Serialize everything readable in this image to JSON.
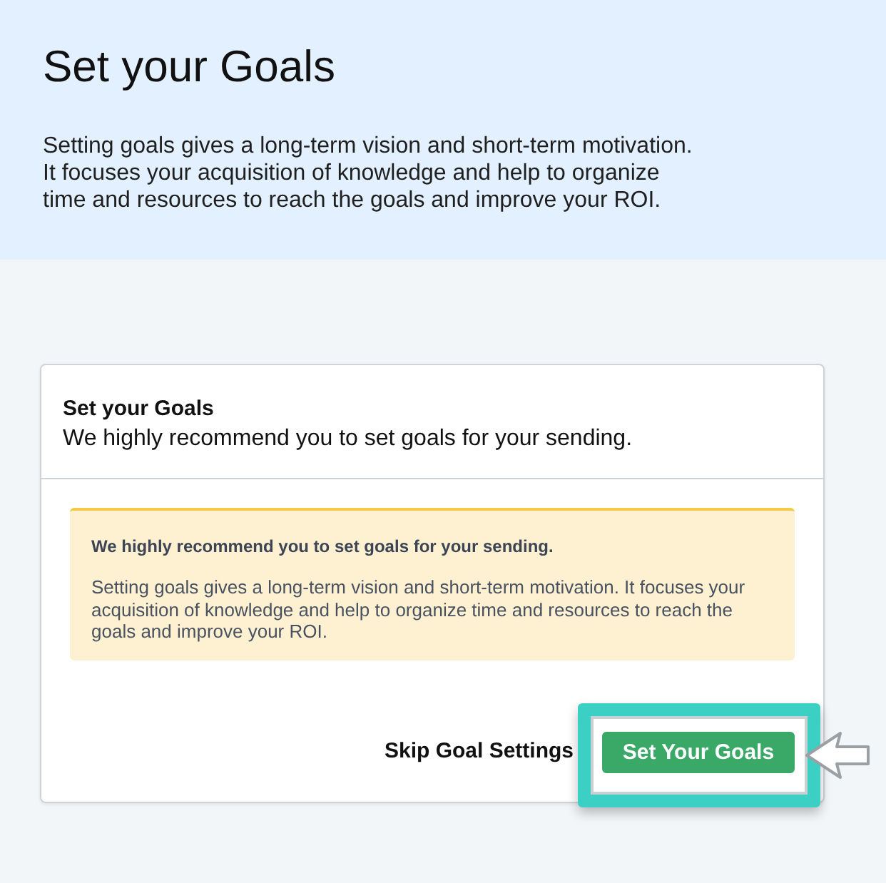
{
  "header": {
    "title": "Set your Goals",
    "description": "Setting goals gives a long-term vision and short-term motivation. It focuses your acquisition of knowledge and help to organize time and resources to reach the goals and improve your ROI."
  },
  "card": {
    "title": "Set your Goals",
    "subtitle": "We highly recommend you to set goals for your sending.",
    "alert": {
      "kind": "warning",
      "heading": "We highly recommend you to set goals for your sending.",
      "body": "Setting goals gives a long-term vision and short-term motivation. It focuses your acquisition of knowledge and help to organize time and resources to reach the goals and improve your ROI."
    },
    "actions": [
      {
        "kind": "link",
        "label": "Skip Goal Settings",
        "highlighted": false
      },
      {
        "kind": "primary",
        "label": "Set Your Goals",
        "highlighted": true
      }
    ]
  }
}
